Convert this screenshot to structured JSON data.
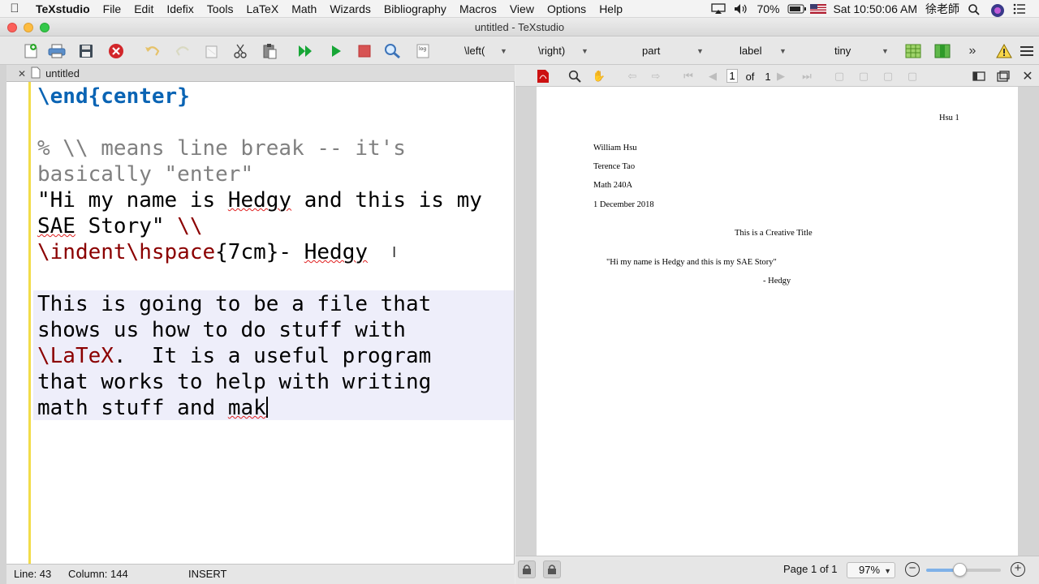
{
  "menubar": {
    "app": "TeXstudio",
    "items": [
      "File",
      "Edit",
      "Idefix",
      "Tools",
      "LaTeX",
      "Math",
      "Wizards",
      "Bibliography",
      "Macros",
      "View",
      "Options",
      "Help"
    ],
    "battery": "70%",
    "clock": "Sat 10:50:06 AM",
    "user": "徐老師"
  },
  "window": {
    "title": "untitled - TeXstudio"
  },
  "toolbar": {
    "left_delim": "\\left(",
    "right_delim": "\\right)",
    "sectioning": "part",
    "refs": "label",
    "size": "tiny"
  },
  "editor": {
    "tab_label": "untitled",
    "lines": [
      {
        "segments": [
          {
            "t": "\\end",
            "c": "kw"
          },
          {
            "t": "{",
            "c": "kw"
          },
          {
            "t": "center",
            "c": "kw"
          },
          {
            "t": "}",
            "c": "kw"
          }
        ]
      },
      {
        "segments": []
      },
      {
        "segments": [
          {
            "t": "% \\\\ means line break -- it's",
            "c": "cmt"
          }
        ]
      },
      {
        "segments": [
          {
            "t": "basically \"enter\"",
            "c": "cmt"
          }
        ]
      },
      {
        "segments": [
          {
            "t": "\"Hi my name is ",
            "c": ""
          },
          {
            "t": "Hedgy",
            "c": "spell"
          },
          {
            "t": " and this is my",
            "c": ""
          }
        ]
      },
      {
        "segments": [
          {
            "t": "SAE",
            "c": "spell"
          },
          {
            "t": " Story\" ",
            "c": ""
          },
          {
            "t": "\\\\",
            "c": "cmd"
          }
        ]
      },
      {
        "segments": [
          {
            "t": "\\indent\\hspace",
            "c": "cmd"
          },
          {
            "t": "{7cm}- ",
            "c": ""
          },
          {
            "t": "Hedgy",
            "c": "spell"
          }
        ]
      },
      {
        "segments": []
      },
      {
        "segments": [
          {
            "t": "This is going to be a file that",
            "c": ""
          }
        ]
      },
      {
        "segments": [
          {
            "t": "shows us how to do stuff with",
            "c": ""
          }
        ]
      },
      {
        "segments": [
          {
            "t": "\\LaTeX",
            "c": "cmd"
          },
          {
            "t": ".  It is a useful program",
            "c": ""
          }
        ]
      },
      {
        "segments": [
          {
            "t": "that works to help with writing",
            "c": ""
          }
        ]
      },
      {
        "segments": [
          {
            "t": "math stuff and ",
            "c": ""
          },
          {
            "t": "mak",
            "c": "spell"
          },
          {
            "t": "",
            "c": "cursor"
          }
        ]
      }
    ]
  },
  "status": {
    "line": "Line: 43",
    "column": "Column: 144",
    "mode": "INSERT"
  },
  "pdf": {
    "page_current": "1",
    "page_of": "of",
    "page_total": "1",
    "header": "Hsu 1",
    "author": "William Hsu",
    "instructor": "Terence Tao",
    "course": "Math 240A",
    "date": "1 December 2018",
    "title": "This is a Creative Title",
    "quote": "\"Hi my name is Hedgy and this is my SAE Story\"",
    "signature": "- Hedgy",
    "page_status": "Page 1 of 1",
    "zoom": "97%",
    "zoom_fraction": 0.45
  }
}
